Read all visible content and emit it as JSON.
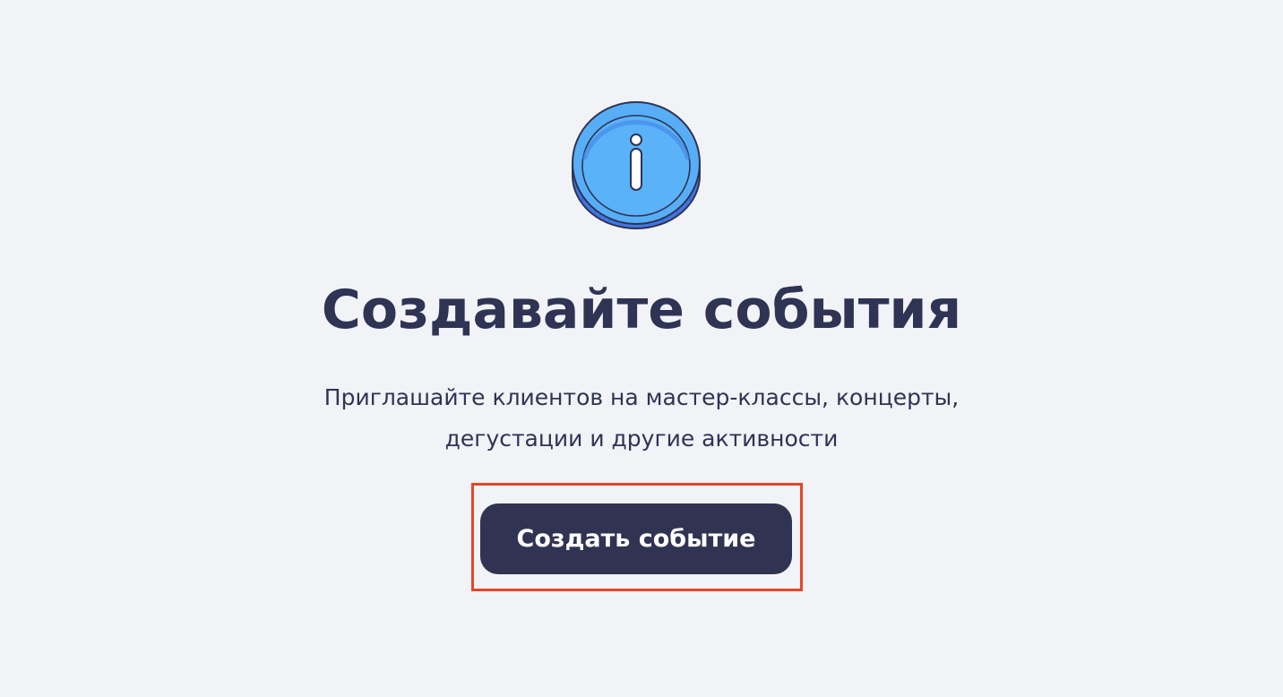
{
  "empty_state": {
    "icon": "info-coin-icon",
    "title": "Создавайте события",
    "description_lines": [
      "Приглашайте клиентов на мастер-классы, концерты,",
      "дегустации и другие активности"
    ],
    "create_button_label": "Создать событие"
  },
  "colors": {
    "background": "#f2f3f7",
    "text": "#2f3354",
    "button": "#303352",
    "icon_fill": "#57aef7",
    "icon_side": "#4077e3",
    "highlight": "#e5452b"
  }
}
